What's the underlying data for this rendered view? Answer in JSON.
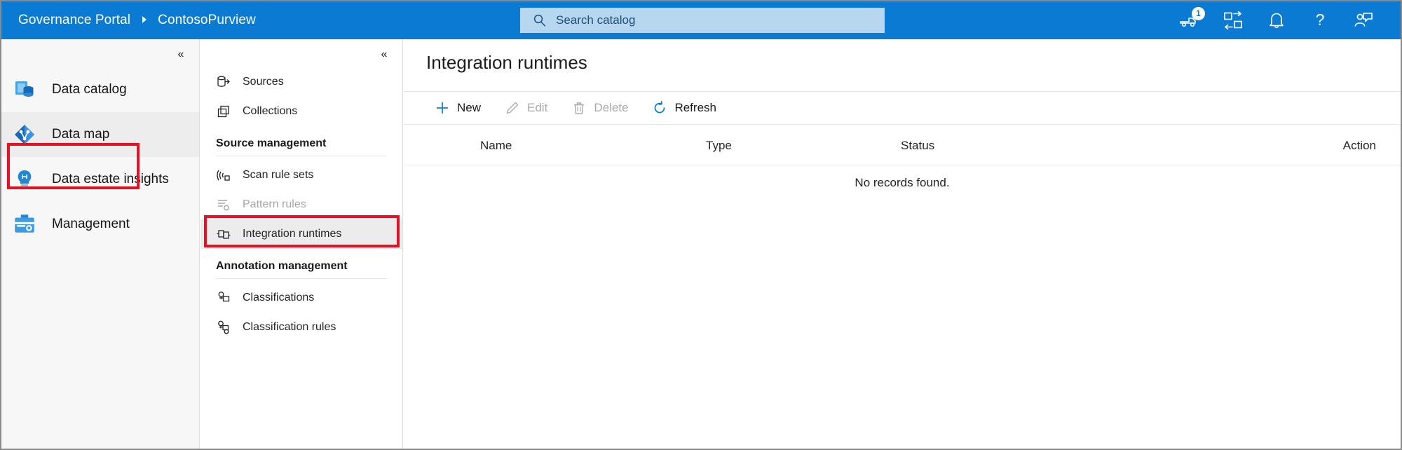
{
  "topbar": {
    "brand": "Governance Portal",
    "separator_icon": "chevron-right-icon",
    "account": "ContosoPurview",
    "background_color": "#0a7ad2",
    "search": {
      "placeholder": "Search catalog",
      "icon": "search-icon",
      "background_color": "#b6d7ef"
    },
    "icons": [
      {
        "name": "shipping-truck-icon",
        "badge": "1"
      },
      {
        "name": "swap-layout-icon",
        "badge": ""
      },
      {
        "name": "notifications-bell-icon",
        "badge": ""
      },
      {
        "name": "help-question-icon",
        "badge": ""
      },
      {
        "name": "feedback-person-icon",
        "badge": ""
      }
    ]
  },
  "left_nav": {
    "collapse_label": "«",
    "collapse_icon": "chevron-double-left-icon",
    "items": [
      {
        "label": "Data catalog",
        "icon": "data-catalog-icon",
        "selected": false
      },
      {
        "label": "Data map",
        "icon": "data-map-icon",
        "selected": true
      },
      {
        "label": "Data estate insights",
        "icon": "data-estate-insights-icon",
        "selected": false
      },
      {
        "label": "Management",
        "icon": "management-toolbox-icon",
        "selected": false
      }
    ]
  },
  "sub_nav": {
    "collapse_label": "«",
    "collapse_icon": "chevron-double-left-icon",
    "items": [
      {
        "type": "item",
        "label": "Sources",
        "icon": "sources-icon",
        "selected": false,
        "disabled": false
      },
      {
        "type": "item",
        "label": "Collections",
        "icon": "collections-icon",
        "selected": false,
        "disabled": false
      },
      {
        "type": "group",
        "label": "Source management"
      },
      {
        "type": "item",
        "label": "Scan rule sets",
        "icon": "scan-rule-sets-icon",
        "selected": false,
        "disabled": false
      },
      {
        "type": "item",
        "label": "Pattern rules",
        "icon": "pattern-rules-icon",
        "selected": false,
        "disabled": true
      },
      {
        "type": "item",
        "label": "Integration runtimes",
        "icon": "integration-runtimes-icon",
        "selected": true,
        "disabled": false
      },
      {
        "type": "group",
        "label": "Annotation management"
      },
      {
        "type": "item",
        "label": "Classifications",
        "icon": "classifications-icon",
        "selected": false,
        "disabled": false
      },
      {
        "type": "item",
        "label": "Classification rules",
        "icon": "classification-rules-icon",
        "selected": false,
        "disabled": false
      }
    ]
  },
  "main": {
    "title": "Integration runtimes",
    "commands": [
      {
        "label": "New",
        "icon": "plus-icon",
        "disabled": false
      },
      {
        "label": "Edit",
        "icon": "pencil-icon",
        "disabled": true
      },
      {
        "label": "Delete",
        "icon": "trash-icon",
        "disabled": true
      },
      {
        "label": "Refresh",
        "icon": "refresh-circular-arrow-icon",
        "disabled": false
      }
    ],
    "table": {
      "columns": [
        "Name",
        "Type",
        "Status",
        "Action"
      ],
      "rows": [],
      "empty_message": "No records found."
    }
  },
  "annotations": {
    "color": "#e81123",
    "boxes": [
      "data-map-nav-item",
      "integration-runtimes-nav-item"
    ]
  }
}
